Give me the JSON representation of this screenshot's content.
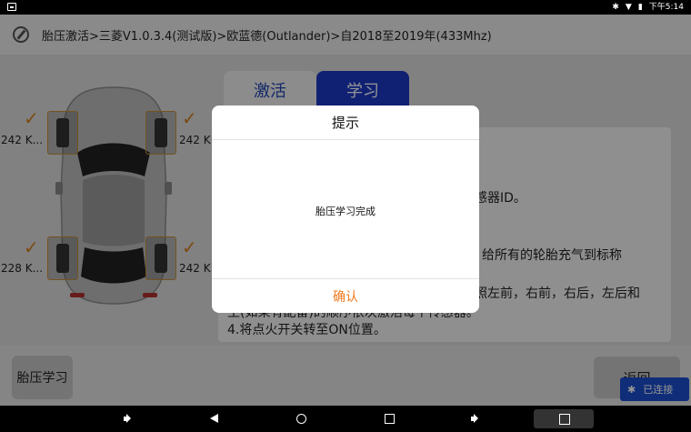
{
  "status": {
    "time": "下午5:14"
  },
  "title": {
    "breadcrumb": "胎压激活>三菱V1.0.3.4(测试版)>欧蓝德(Outlander)>自2018至2019年(433Mhz)"
  },
  "tabs": [
    {
      "label": "激活",
      "active": false
    },
    {
      "label": "学习",
      "active": true
    }
  ],
  "instructions": {
    "line1": "传感器ID。",
    "line2": "给所有的轮胎充气到标称",
    "line3": "照左前，右前，右后，左后和",
    "line4": "主(如果有配备)的顺序依次激活每个传感器。",
    "line5": "4.将点火开关转至ON位置。"
  },
  "tires": {
    "front_left": "242 K...",
    "front_right": "242 K...",
    "rear_left": "228 K...",
    "rear_right": "242 K..."
  },
  "buttons": {
    "tpms_learn": "胎压学习",
    "back": "返回",
    "connected": "已连接"
  },
  "dialog": {
    "title": "提示",
    "message": "胎压学习完成",
    "ok": "确认"
  },
  "colors": {
    "tab_active": "#1c39c6",
    "tab_inactive_text": "#2147b5",
    "check": "#d6821c",
    "dialog_ok": "#f07a1e",
    "connected_badge": "#1a4fcf"
  }
}
